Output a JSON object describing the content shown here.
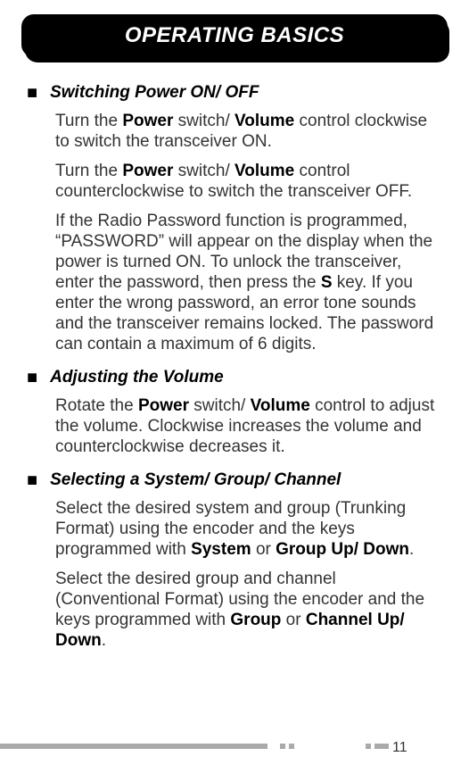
{
  "header": {
    "title": "OPERATING BASICS"
  },
  "sections": [
    {
      "title": "Switching Power ON/ OFF",
      "paras": [
        "Turn the <strong>Power</strong> switch/ <strong>Volume</strong> control clockwise to switch the transceiver ON.",
        "Turn the <strong>Power</strong> switch/ <strong>Volume</strong> control counterclockwise to switch the transceiver OFF.",
        "If the Radio Password function is programmed, “PASSWORD” will appear on the display when the power is turned ON.  To unlock the transceiver, enter the password, then press the <strong>S</strong> key.  If you enter the wrong password, an error tone sounds and the transceiver remains locked.  The password can contain a maximum of 6 digits."
      ]
    },
    {
      "title": "Adjusting the Volume",
      "paras": [
        "Rotate the <strong>Power</strong> switch/ <strong>Volume</strong> control to adjust the volume.  Clockwise increases the volume and counterclockwise decreases it."
      ]
    },
    {
      "title": "Selecting a System/ Group/ Channel",
      "paras": [
        "Select the desired system and group (Trunking Format) using the encoder and the keys programmed with <strong>System</strong> or <strong>Group Up/ Down</strong>.",
        "Select the desired group and channel (Conventional Format) using the encoder and the keys programmed with <strong>Group</strong> or <strong>Channel Up/ Down</strong>."
      ]
    }
  ],
  "page_number": "11"
}
